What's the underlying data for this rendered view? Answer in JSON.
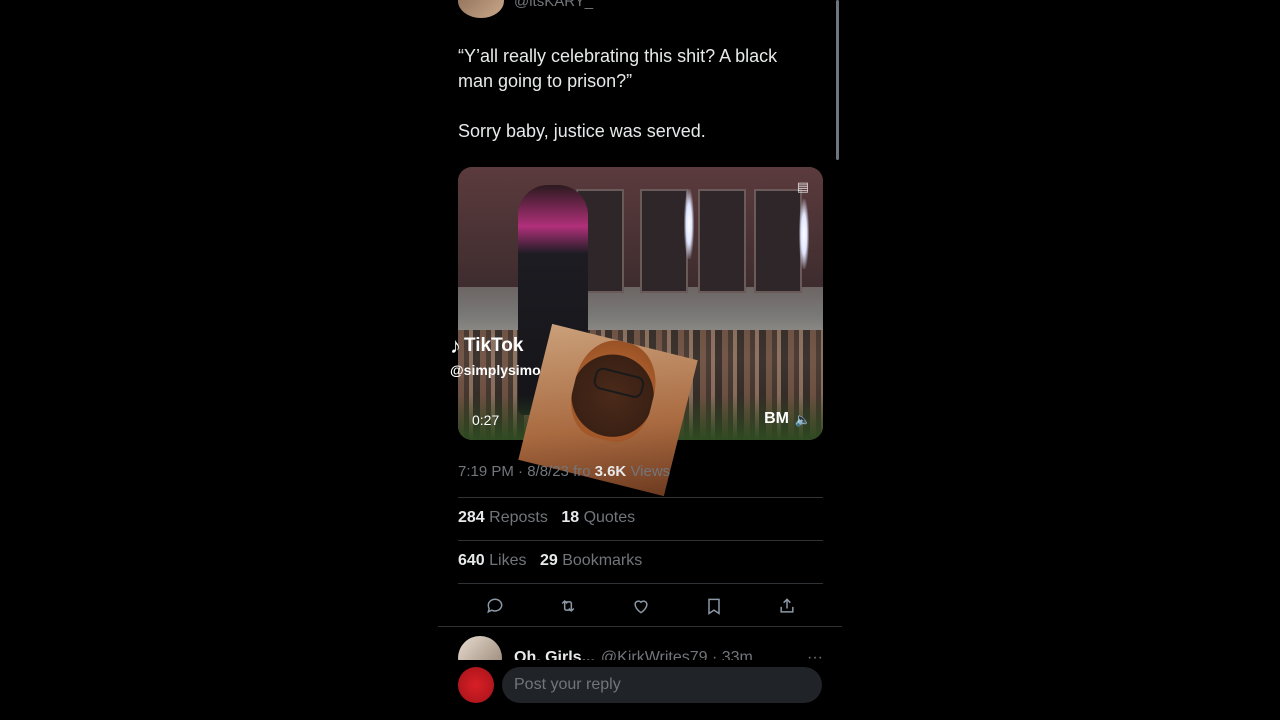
{
  "tweet": {
    "handle": "@itsKARY_",
    "paragraphs": [
      "“Y’all really celebrating this shit? A black man going to prison?”",
      "Sorry baby, justice was served."
    ],
    "media": {
      "duration": "0:27",
      "watermark_logo": "BM",
      "tiktok_label": "TikTok",
      "tiktok_user": "@simplysimone"
    },
    "meta": {
      "time_date": "7:19 PM · 8/8/23 fro",
      "views_count": "3.6K",
      "views_label": "Views"
    },
    "stats": {
      "reposts": {
        "count": "284",
        "label": "Reposts"
      },
      "quotes": {
        "count": "18",
        "label": "Quotes"
      },
      "likes": {
        "count": "640",
        "label": "Likes"
      },
      "bookmarks": {
        "count": "29",
        "label": "Bookmarks"
      }
    },
    "actions": [
      "reply-icon",
      "repost-icon",
      "like-icon",
      "bookmark-icon",
      "share-icon"
    ]
  },
  "reply_preview": {
    "name": "Oh, Girls...",
    "handle_time": "@KirkWrites79 · 33m",
    "more": "···"
  },
  "composer": {
    "placeholder": "Post your reply"
  },
  "colors": {
    "background": "#000000",
    "text_primary": "#e7e9ea",
    "text_secondary": "#71767b",
    "divider": "#2f3336"
  }
}
